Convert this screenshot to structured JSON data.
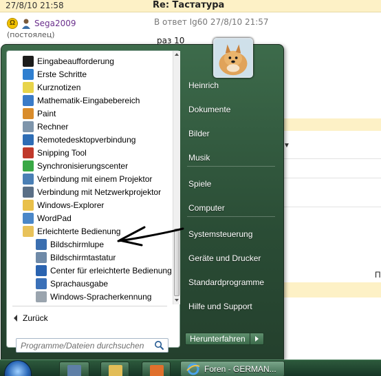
{
  "forum": {
    "date": "27/8/10 21:58",
    "title": "Re: Тастатура",
    "username": "Sega2009",
    "user_status": "(постоялец)",
    "reply_to": "В ответ Ig60 27/8/10 21:57",
    "post_text": "раз 10",
    "edge_letter": "П"
  },
  "start_menu": {
    "programs": [
      {
        "label": "Eingabeaufforderung",
        "icon": "cmd-icon",
        "color": "#1c1c1c"
      },
      {
        "label": "Erste Schritte",
        "icon": "getting-started-icon",
        "color": "#2f7fd0"
      },
      {
        "label": "Kurznotizen",
        "icon": "sticky-notes-icon",
        "color": "#e8d44a"
      },
      {
        "label": "Mathematik-Eingabebereich",
        "icon": "math-input-icon",
        "color": "#3a7bc8"
      },
      {
        "label": "Paint",
        "icon": "paint-icon",
        "color": "#d98c2b"
      },
      {
        "label": "Rechner",
        "icon": "calculator-icon",
        "color": "#7e95ab"
      },
      {
        "label": "Remotedesktopverbindung",
        "icon": "remote-desktop-icon",
        "color": "#2e6db5"
      },
      {
        "label": "Snipping Tool",
        "icon": "snipping-tool-icon",
        "color": "#c0392b"
      },
      {
        "label": "Synchronisierungscenter",
        "icon": "sync-center-icon",
        "color": "#39a845"
      },
      {
        "label": "Verbindung mit einem Projektor",
        "icon": "projector-icon",
        "color": "#4a7fb5"
      },
      {
        "label": "Verbindung mit Netzwerkprojektor",
        "icon": "network-projector-icon",
        "color": "#5a6f86"
      },
      {
        "label": "Windows-Explorer",
        "icon": "explorer-icon",
        "color": "#e9c04a"
      },
      {
        "label": "WordPad",
        "icon": "wordpad-icon",
        "color": "#4b87c8"
      },
      {
        "label": "Erleichterte Bedienung",
        "icon": "folder-icon",
        "color": "#e8c25a"
      },
      {
        "label": "Bildschirmlupe",
        "icon": "magnifier-icon",
        "color": "#3b6fb0"
      },
      {
        "label": "Bildschirmtastatur",
        "icon": "keyboard-icon",
        "color": "#6f8aa8"
      },
      {
        "label": "Center für erleichterte Bedienung",
        "icon": "ease-of-access-icon",
        "color": "#2a63b0"
      },
      {
        "label": "Sprachausgabe",
        "icon": "narrator-icon",
        "color": "#3a70b8"
      },
      {
        "label": "Windows-Spracherkennung",
        "icon": "microphone-icon",
        "color": "#9aa4ae"
      }
    ],
    "back_label": "Zurück",
    "search_placeholder": "Programme/Dateien durchsuchen",
    "right_items": [
      "Heinrich",
      "Dokumente",
      "Bilder",
      "Musik",
      "Spiele",
      "Computer",
      "Systemsteuerung",
      "Geräte und Drucker",
      "Standardprogramme",
      "Hilfe und Support"
    ],
    "shutdown_label": "Herunterfahren"
  },
  "taskbar": {
    "active_task_label": "Foren - GERMAN..."
  }
}
